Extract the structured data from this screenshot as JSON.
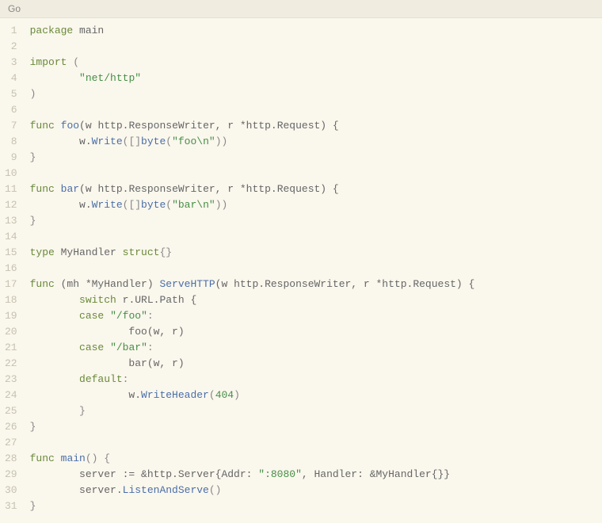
{
  "header": {
    "language": "Go"
  },
  "lines": [
    [
      {
        "t": "package",
        "c": "kw"
      },
      {
        "t": " ",
        "c": "pn"
      },
      {
        "t": "main",
        "c": "plain"
      }
    ],
    [],
    [
      {
        "t": "import",
        "c": "kw"
      },
      {
        "t": " (",
        "c": "pn"
      }
    ],
    [
      {
        "t": "        ",
        "c": "pn"
      },
      {
        "t": "\"net/http\"",
        "c": "str"
      }
    ],
    [
      {
        "t": ")",
        "c": "pn"
      }
    ],
    [],
    [
      {
        "t": "func",
        "c": "kw"
      },
      {
        "t": " ",
        "c": "pn"
      },
      {
        "t": "foo",
        "c": "id"
      },
      {
        "t": "(w http.ResponseWriter, r *http.Request) {",
        "c": "plain"
      }
    ],
    [
      {
        "t": "        w.",
        "c": "plain"
      },
      {
        "t": "Write",
        "c": "id"
      },
      {
        "t": "([]",
        "c": "pn"
      },
      {
        "t": "byte",
        "c": "id"
      },
      {
        "t": "(",
        "c": "pn"
      },
      {
        "t": "\"foo\\n\"",
        "c": "str"
      },
      {
        "t": "))",
        "c": "pn"
      }
    ],
    [
      {
        "t": "}",
        "c": "pn"
      }
    ],
    [],
    [
      {
        "t": "func",
        "c": "kw"
      },
      {
        "t": " ",
        "c": "pn"
      },
      {
        "t": "bar",
        "c": "id"
      },
      {
        "t": "(w http.ResponseWriter, r *http.Request) {",
        "c": "plain"
      }
    ],
    [
      {
        "t": "        w.",
        "c": "plain"
      },
      {
        "t": "Write",
        "c": "id"
      },
      {
        "t": "([]",
        "c": "pn"
      },
      {
        "t": "byte",
        "c": "id"
      },
      {
        "t": "(",
        "c": "pn"
      },
      {
        "t": "\"bar\\n\"",
        "c": "str"
      },
      {
        "t": "))",
        "c": "pn"
      }
    ],
    [
      {
        "t": "}",
        "c": "pn"
      }
    ],
    [],
    [
      {
        "t": "type",
        "c": "kw"
      },
      {
        "t": " MyHandler ",
        "c": "plain"
      },
      {
        "t": "struct",
        "c": "kw"
      },
      {
        "t": "{}",
        "c": "pn"
      }
    ],
    [],
    [
      {
        "t": "func",
        "c": "kw"
      },
      {
        "t": " (mh *MyHandler) ",
        "c": "plain"
      },
      {
        "t": "ServeHTTP",
        "c": "id"
      },
      {
        "t": "(w http.ResponseWriter, r *http.Request) {",
        "c": "plain"
      }
    ],
    [
      {
        "t": "        ",
        "c": "pn"
      },
      {
        "t": "switch",
        "c": "kw"
      },
      {
        "t": " r.URL.Path {",
        "c": "plain"
      }
    ],
    [
      {
        "t": "        ",
        "c": "pn"
      },
      {
        "t": "case",
        "c": "kw"
      },
      {
        "t": " ",
        "c": "pn"
      },
      {
        "t": "\"/foo\"",
        "c": "str"
      },
      {
        "t": ":",
        "c": "pn"
      }
    ],
    [
      {
        "t": "                foo(w, r)",
        "c": "plain"
      }
    ],
    [
      {
        "t": "        ",
        "c": "pn"
      },
      {
        "t": "case",
        "c": "kw"
      },
      {
        "t": " ",
        "c": "pn"
      },
      {
        "t": "\"/bar\"",
        "c": "str"
      },
      {
        "t": ":",
        "c": "pn"
      }
    ],
    [
      {
        "t": "                bar(w, r)",
        "c": "plain"
      }
    ],
    [
      {
        "t": "        ",
        "c": "pn"
      },
      {
        "t": "default",
        "c": "kw"
      },
      {
        "t": ":",
        "c": "pn"
      }
    ],
    [
      {
        "t": "                w.",
        "c": "plain"
      },
      {
        "t": "WriteHeader",
        "c": "id"
      },
      {
        "t": "(",
        "c": "pn"
      },
      {
        "t": "404",
        "c": "numc"
      },
      {
        "t": ")",
        "c": "pn"
      }
    ],
    [
      {
        "t": "        }",
        "c": "pn"
      }
    ],
    [
      {
        "t": "}",
        "c": "pn"
      }
    ],
    [],
    [
      {
        "t": "func",
        "c": "kw"
      },
      {
        "t": " ",
        "c": "pn"
      },
      {
        "t": "main",
        "c": "id"
      },
      {
        "t": "() {",
        "c": "pn"
      }
    ],
    [
      {
        "t": "        server := &http.Server{Addr: ",
        "c": "plain"
      },
      {
        "t": "\":8080\"",
        "c": "str"
      },
      {
        "t": ", Handler: &MyHandler{}}",
        "c": "plain"
      }
    ],
    [
      {
        "t": "        server.",
        "c": "plain"
      },
      {
        "t": "ListenAndServe",
        "c": "id"
      },
      {
        "t": "()",
        "c": "pn"
      }
    ],
    [
      {
        "t": "}",
        "c": "pn"
      }
    ]
  ]
}
